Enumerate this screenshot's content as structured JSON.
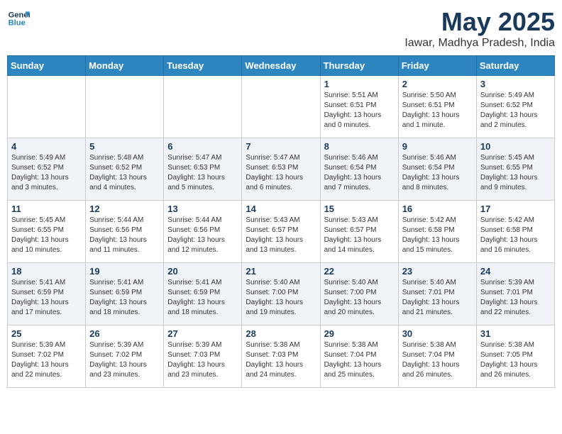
{
  "logo": {
    "line1": "General",
    "line2": "Blue"
  },
  "title": "May 2025",
  "subtitle": "Iawar, Madhya Pradesh, India",
  "weekdays": [
    "Sunday",
    "Monday",
    "Tuesday",
    "Wednesday",
    "Thursday",
    "Friday",
    "Saturday"
  ],
  "weeks": [
    [
      {
        "day": "",
        "info": ""
      },
      {
        "day": "",
        "info": ""
      },
      {
        "day": "",
        "info": ""
      },
      {
        "day": "",
        "info": ""
      },
      {
        "day": "1",
        "info": "Sunrise: 5:51 AM\nSunset: 6:51 PM\nDaylight: 13 hours and 0 minutes."
      },
      {
        "day": "2",
        "info": "Sunrise: 5:50 AM\nSunset: 6:51 PM\nDaylight: 13 hours and 1 minute."
      },
      {
        "day": "3",
        "info": "Sunrise: 5:49 AM\nSunset: 6:52 PM\nDaylight: 13 hours and 2 minutes."
      }
    ],
    [
      {
        "day": "4",
        "info": "Sunrise: 5:49 AM\nSunset: 6:52 PM\nDaylight: 13 hours and 3 minutes."
      },
      {
        "day": "5",
        "info": "Sunrise: 5:48 AM\nSunset: 6:52 PM\nDaylight: 13 hours and 4 minutes."
      },
      {
        "day": "6",
        "info": "Sunrise: 5:47 AM\nSunset: 6:53 PM\nDaylight: 13 hours and 5 minutes."
      },
      {
        "day": "7",
        "info": "Sunrise: 5:47 AM\nSunset: 6:53 PM\nDaylight: 13 hours and 6 minutes."
      },
      {
        "day": "8",
        "info": "Sunrise: 5:46 AM\nSunset: 6:54 PM\nDaylight: 13 hours and 7 minutes."
      },
      {
        "day": "9",
        "info": "Sunrise: 5:46 AM\nSunset: 6:54 PM\nDaylight: 13 hours and 8 minutes."
      },
      {
        "day": "10",
        "info": "Sunrise: 5:45 AM\nSunset: 6:55 PM\nDaylight: 13 hours and 9 minutes."
      }
    ],
    [
      {
        "day": "11",
        "info": "Sunrise: 5:45 AM\nSunset: 6:55 PM\nDaylight: 13 hours and 10 minutes."
      },
      {
        "day": "12",
        "info": "Sunrise: 5:44 AM\nSunset: 6:56 PM\nDaylight: 13 hours and 11 minutes."
      },
      {
        "day": "13",
        "info": "Sunrise: 5:44 AM\nSunset: 6:56 PM\nDaylight: 13 hours and 12 minutes."
      },
      {
        "day": "14",
        "info": "Sunrise: 5:43 AM\nSunset: 6:57 PM\nDaylight: 13 hours and 13 minutes."
      },
      {
        "day": "15",
        "info": "Sunrise: 5:43 AM\nSunset: 6:57 PM\nDaylight: 13 hours and 14 minutes."
      },
      {
        "day": "16",
        "info": "Sunrise: 5:42 AM\nSunset: 6:58 PM\nDaylight: 13 hours and 15 minutes."
      },
      {
        "day": "17",
        "info": "Sunrise: 5:42 AM\nSunset: 6:58 PM\nDaylight: 13 hours and 16 minutes."
      }
    ],
    [
      {
        "day": "18",
        "info": "Sunrise: 5:41 AM\nSunset: 6:59 PM\nDaylight: 13 hours and 17 minutes."
      },
      {
        "day": "19",
        "info": "Sunrise: 5:41 AM\nSunset: 6:59 PM\nDaylight: 13 hours and 18 minutes."
      },
      {
        "day": "20",
        "info": "Sunrise: 5:41 AM\nSunset: 6:59 PM\nDaylight: 13 hours and 18 minutes."
      },
      {
        "day": "21",
        "info": "Sunrise: 5:40 AM\nSunset: 7:00 PM\nDaylight: 13 hours and 19 minutes."
      },
      {
        "day": "22",
        "info": "Sunrise: 5:40 AM\nSunset: 7:00 PM\nDaylight: 13 hours and 20 minutes."
      },
      {
        "day": "23",
        "info": "Sunrise: 5:40 AM\nSunset: 7:01 PM\nDaylight: 13 hours and 21 minutes."
      },
      {
        "day": "24",
        "info": "Sunrise: 5:39 AM\nSunset: 7:01 PM\nDaylight: 13 hours and 22 minutes."
      }
    ],
    [
      {
        "day": "25",
        "info": "Sunrise: 5:39 AM\nSunset: 7:02 PM\nDaylight: 13 hours and 22 minutes."
      },
      {
        "day": "26",
        "info": "Sunrise: 5:39 AM\nSunset: 7:02 PM\nDaylight: 13 hours and 23 minutes."
      },
      {
        "day": "27",
        "info": "Sunrise: 5:39 AM\nSunset: 7:03 PM\nDaylight: 13 hours and 23 minutes."
      },
      {
        "day": "28",
        "info": "Sunrise: 5:38 AM\nSunset: 7:03 PM\nDaylight: 13 hours and 24 minutes."
      },
      {
        "day": "29",
        "info": "Sunrise: 5:38 AM\nSunset: 7:04 PM\nDaylight: 13 hours and 25 minutes."
      },
      {
        "day": "30",
        "info": "Sunrise: 5:38 AM\nSunset: 7:04 PM\nDaylight: 13 hours and 26 minutes."
      },
      {
        "day": "31",
        "info": "Sunrise: 5:38 AM\nSunset: 7:05 PM\nDaylight: 13 hours and 26 minutes."
      }
    ]
  ]
}
